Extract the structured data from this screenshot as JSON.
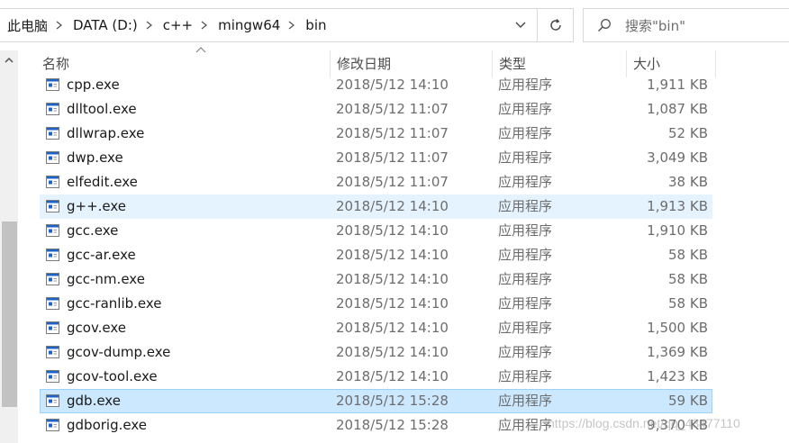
{
  "breadcrumb": [
    "此电脑",
    "DATA (D:)",
    "c++",
    "mingw64",
    "bin"
  ],
  "search": {
    "placeholder": "搜索\"bin\""
  },
  "columns": {
    "name": "名称",
    "date": "修改日期",
    "type": "类型",
    "size": "大小"
  },
  "files": [
    {
      "name": "cpp.exe",
      "date": "2018/5/12 14:10",
      "type": "应用程序",
      "size": "1,911 KB",
      "state": ""
    },
    {
      "name": "dlltool.exe",
      "date": "2018/5/12 11:07",
      "type": "应用程序",
      "size": "1,087 KB",
      "state": ""
    },
    {
      "name": "dllwrap.exe",
      "date": "2018/5/12 11:07",
      "type": "应用程序",
      "size": "52 KB",
      "state": ""
    },
    {
      "name": "dwp.exe",
      "date": "2018/5/12 11:07",
      "type": "应用程序",
      "size": "3,049 KB",
      "state": ""
    },
    {
      "name": "elfedit.exe",
      "date": "2018/5/12 11:07",
      "type": "应用程序",
      "size": "38 KB",
      "state": ""
    },
    {
      "name": "g++.exe",
      "date": "2018/5/12 14:10",
      "type": "应用程序",
      "size": "1,913 KB",
      "state": "hover"
    },
    {
      "name": "gcc.exe",
      "date": "2018/5/12 14:10",
      "type": "应用程序",
      "size": "1,910 KB",
      "state": ""
    },
    {
      "name": "gcc-ar.exe",
      "date": "2018/5/12 14:10",
      "type": "应用程序",
      "size": "58 KB",
      "state": ""
    },
    {
      "name": "gcc-nm.exe",
      "date": "2018/5/12 14:10",
      "type": "应用程序",
      "size": "58 KB",
      "state": ""
    },
    {
      "name": "gcc-ranlib.exe",
      "date": "2018/5/12 14:10",
      "type": "应用程序",
      "size": "58 KB",
      "state": ""
    },
    {
      "name": "gcov.exe",
      "date": "2018/5/12 14:10",
      "type": "应用程序",
      "size": "1,500 KB",
      "state": ""
    },
    {
      "name": "gcov-dump.exe",
      "date": "2018/5/12 14:10",
      "type": "应用程序",
      "size": "1,369 KB",
      "state": ""
    },
    {
      "name": "gcov-tool.exe",
      "date": "2018/5/12 14:10",
      "type": "应用程序",
      "size": "1,423 KB",
      "state": ""
    },
    {
      "name": "gdb.exe",
      "date": "2018/5/12 15:28",
      "type": "应用程序",
      "size": "59 KB",
      "state": "selected"
    },
    {
      "name": "gdborig.exe",
      "date": "2018/5/12 15:28",
      "type": "应用程序",
      "size": "9,370 KB",
      "state": ""
    }
  ],
  "watermark": "https://blog.csdn.net/qq_43477110",
  "colors": {
    "hover": "#e5f3ff",
    "selected": "#cce8ff",
    "selected_border": "#99d1ff",
    "exe_icon_blue": "#1e63c7"
  },
  "icons": {
    "refresh": "refresh-icon",
    "search": "search-icon",
    "dropdown": "chevron-down-icon",
    "separator": "chevron-right-icon",
    "file": "exe-file-icon"
  }
}
